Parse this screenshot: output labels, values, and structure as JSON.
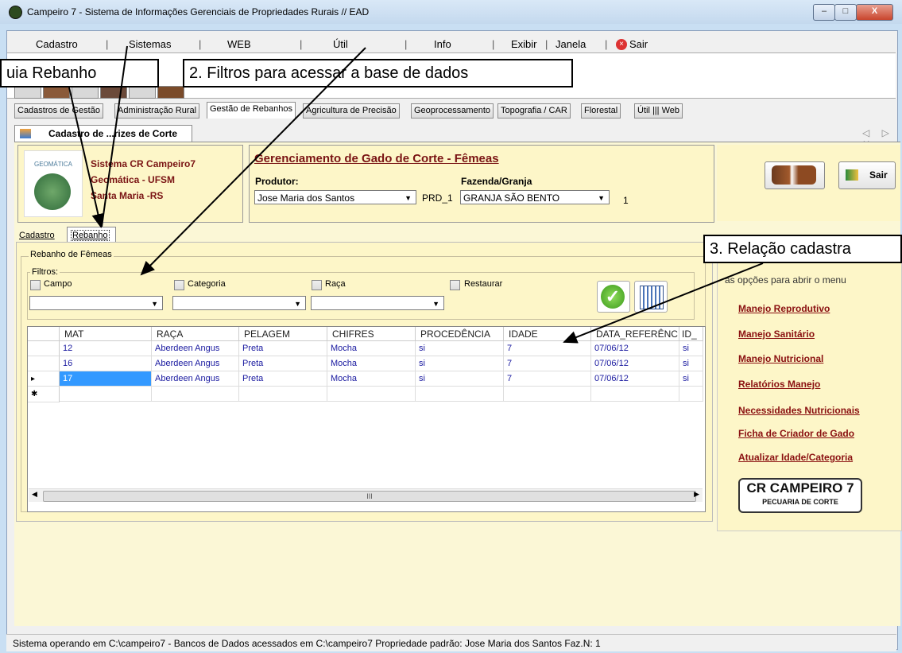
{
  "window": {
    "title": "Campeiro 7 - Sistema de Informações Gerenciais de Propriedades Rurais // EAD",
    "min_label": "–",
    "max_label": "□",
    "close_label": "X"
  },
  "menu": {
    "items": [
      "Cadastro",
      "Sistemas",
      "WEB",
      "Útil",
      "Info",
      "Exibir",
      "Janela"
    ],
    "sair": "Sair"
  },
  "main_tabs": [
    "Cadastros de Gestão",
    "Administração Rural",
    "Gestão de Rebanhos",
    "Agricultura de Precisão",
    "Geoprocessamento",
    "Topografia / CAR",
    "Florestal",
    "Útil ||| Web"
  ],
  "doc_tab": {
    "label": "Cadastro de ...rizes de Corte"
  },
  "doc_nav": "◁ ▷ ✕",
  "sys_panel": {
    "logo_text": "GEOMÁTICA",
    "line1": "Sistema CR Campeiro7",
    "line2": "Geomática - UFSM",
    "line3": "Santa Maria -RS"
  },
  "header": {
    "title": "Gerenciamento de Gado de Corte - Fêmeas",
    "produtor_label": "Produtor:",
    "produtor_value": "Jose Maria dos Santos",
    "prd_code": "PRD_1",
    "fazenda_label": "Fazenda/Granja",
    "fazenda_value": "GRANJA SÃO BENTO",
    "fazenda_num": "1",
    "sair": "Sair"
  },
  "inner_tabs": {
    "cadastro": "Cadastro",
    "rebanho": "Rebanho"
  },
  "rebanho_group": "Rebanho de Fêmeas",
  "filtros": {
    "legend": "Filtros:",
    "campo": "Campo",
    "categoria": "Categoria",
    "raca": "Raça",
    "restaurar": "Restaurar"
  },
  "grid": {
    "columns": [
      "MAT",
      "RAÇA",
      "PELAGEM",
      "CHIFRES",
      "PROCEDÊNCIA",
      "IDADE",
      "DATA_REFERÊNC",
      "ID_"
    ],
    "rows": [
      [
        "12",
        "Aberdeen Angus",
        "Preta",
        "Mocha",
        "si",
        "7",
        "07/06/12",
        "si"
      ],
      [
        "16",
        "Aberdeen Angus",
        "Preta",
        "Mocha",
        "si",
        "7",
        "07/06/12",
        "si"
      ],
      [
        "17",
        "Aberdeen Angus",
        "Preta",
        "Mocha",
        "si",
        "7",
        "07/06/12",
        "si"
      ]
    ],
    "current_marker": "▸",
    "new_marker": "✱",
    "scroll_thumb": "III"
  },
  "right_menu": {
    "hint": "as opções para abrir o menu",
    "links": [
      "Manejo Reprodutivo",
      "Manejo Sanitário",
      "Manejo Nutricional",
      "Relatórios Manejo",
      "Necessidades Nutricionais",
      "Ficha de Criador de Gado",
      "Atualizar Idade/Categoria"
    ],
    "logo_line1": "CR CAMPEIRO 7",
    "logo_line2": "PECUARIA DE CORTE"
  },
  "status": "Sistema operando em C:\\campeiro7  -  Bancos de Dados acessados em C:\\campeiro7  Propriedade padrão: Jose Maria dos Santos Faz.N: 1",
  "callouts": {
    "c1": "uia Rebanho",
    "c2": "2. Filtros para acessar a base de dados",
    "c3": "3. Relação cadastra"
  }
}
